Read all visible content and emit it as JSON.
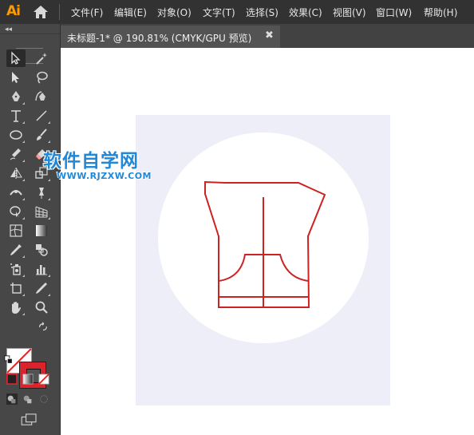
{
  "app": {
    "logo_text": "Ai"
  },
  "menu": {
    "items": [
      {
        "label": "文件(F)"
      },
      {
        "label": "编辑(E)"
      },
      {
        "label": "对象(O)"
      },
      {
        "label": "文字(T)"
      },
      {
        "label": "选择(S)"
      },
      {
        "label": "效果(C)"
      },
      {
        "label": "视图(V)"
      },
      {
        "label": "窗口(W)"
      },
      {
        "label": "帮助(H)"
      }
    ]
  },
  "document_tab": {
    "title": "未标题-1* @ 190.81% (CMYK/GPU 预览)",
    "close_glyph": "✖"
  },
  "tool_panel": {
    "collapse_glyph": "◂◂",
    "tools": [
      {
        "name": "selection-tool-icon"
      },
      {
        "name": "magic-wand-tool-icon"
      },
      {
        "name": "direct-selection-tool-icon"
      },
      {
        "name": "lasso-tool-icon"
      },
      {
        "name": "pen-tool-icon"
      },
      {
        "name": "curvature-tool-icon"
      },
      {
        "name": "type-tool-icon"
      },
      {
        "name": "line-segment-tool-icon"
      },
      {
        "name": "ellipse-tool-icon"
      },
      {
        "name": "paintbrush-tool-icon"
      },
      {
        "name": "shaper-tool-icon"
      },
      {
        "name": "eraser-tool-icon"
      },
      {
        "name": "reflect-tool-icon"
      },
      {
        "name": "scale-tool-icon"
      },
      {
        "name": "width-tool-icon"
      },
      {
        "name": "puppet-warp-tool-icon"
      },
      {
        "name": "shape-builder-tool-icon"
      },
      {
        "name": "perspective-grid-tool-icon"
      },
      {
        "name": "mesh-tool-icon"
      },
      {
        "name": "gradient-tool-icon"
      },
      {
        "name": "eyedropper-tool-icon"
      },
      {
        "name": "blend-tool-icon"
      },
      {
        "name": "symbol-sprayer-tool-icon"
      },
      {
        "name": "column-graph-tool-icon"
      },
      {
        "name": "artboard-tool-icon"
      },
      {
        "name": "slice-tool-icon"
      },
      {
        "name": "hand-tool-icon"
      },
      {
        "name": "zoom-tool-icon"
      }
    ],
    "fill_color": "#ffffff",
    "stroke_color": "#d9232d"
  },
  "canvas": {
    "background": "#ffffff",
    "artboard_color": "#eeeef8",
    "circle_color": "#ffffff",
    "shape_stroke_color": "#cc2222"
  },
  "watermark": {
    "title": "软件自学网",
    "url": "WWW.RJZXW.COM",
    "color": "#1f88d8"
  }
}
